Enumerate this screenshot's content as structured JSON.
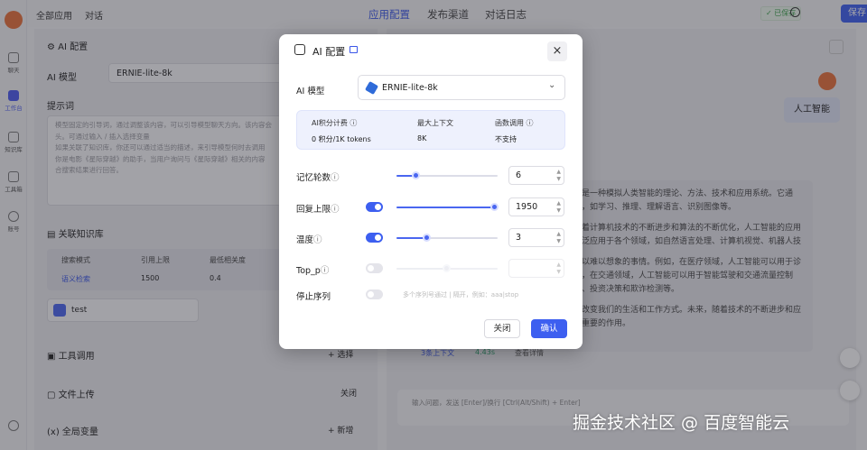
{
  "topbar": {
    "nav_all_apps": "全部应用",
    "nav_chat": "对话",
    "tabs": [
      "应用配置",
      "发布渠道",
      "对话日志"
    ],
    "saved": "✓ 已保存",
    "publish": "保存"
  },
  "rail": {
    "items": [
      "聊天",
      "工作台",
      "知识库",
      "工具箱",
      "账号"
    ]
  },
  "left": {
    "ai_config_title": "AI 配置",
    "model_label": "AI 模型",
    "model_value": "ERNIE-lite-8k",
    "prompt_label": "提示词",
    "prompt_lines": [
      "模型固定的引导词，通过调整该内容，可以引导模型聊天方向。该内容会",
      "头。可通过输入 / 插入选择变量",
      "如果关联了知识库，你还可以通过适当的描述，来引导模型何时去调用",
      "你是电影《星际穿越》的助手，当用户询问与《星际穿越》相关的内容",
      "合搜索结果进行回答。"
    ],
    "kb_title": "关联知识库",
    "kb_headers": [
      "搜索模式",
      "引用上限",
      "最低相关度"
    ],
    "kb_row": [
      "语义检索",
      "1500",
      "0.4"
    ],
    "kb_item": "test",
    "tools_title": "工具调用",
    "tools_action": "+ 选择",
    "upload_title": "文件上传",
    "upload_action": "关闭",
    "vars_title": "全局变量",
    "vars_action": "+ 新增"
  },
  "right": {
    "user_bubble": "人工智能",
    "answer_paragraphs": [
      "是一种模拟人类智能的理论、方法、技术和应用系统。它通",
      "，如学习、推理、理解语言、识别图像等。",
      "着计算机技术的不断进步和算法的不断优化，人工智能的应用",
      "泛应用于各个领域，如自然语言处理、计算机视觉、机器人技",
      "以难以想象的事情。例如，在医疗领域，人工智能可以用于诊",
      "，在交通领域，人工智能可以用于智能驾驶和交通流量控制",
      "、投资决策和欺诈检测等。",
      "改变我们的生活和工作方式。未来，随着技术的不断进步和应",
      "重要的作用。"
    ],
    "meta": [
      "3条上下文",
      "4.43s",
      "查看详情"
    ],
    "input_placeholder": "输入问题，发送 [Enter]/换行 [Ctrl(Alt/Shift) + Enter]"
  },
  "watermark": "掘金技术社区 @ 百度智能云",
  "modal": {
    "title": "AI 配置",
    "model_label": "AI 模型",
    "model_value": "ERNIE-lite-8k",
    "info_headers": [
      "AI积分计费",
      "最大上下文",
      "函数调用"
    ],
    "info_values": [
      "0 积分/1K tokens",
      "8K",
      "不支持"
    ],
    "params": [
      {
        "label": "记忆轮数",
        "value": "6",
        "enabled": true,
        "fraction": 0.2
      },
      {
        "label": "回复上限",
        "value": "1950",
        "enabled": true,
        "fraction": 0.97
      },
      {
        "label": "温度",
        "value": "3",
        "enabled": true,
        "fraction": 0.3
      },
      {
        "label": "Top_p",
        "value": "",
        "enabled": false,
        "fraction": 0.5
      }
    ],
    "stop_label": "停止序列",
    "stop_placeholder": "多个序列号通过 | 隔开，例如：aaa|stop",
    "cancel": "关闭",
    "confirm": "确认",
    "accent": "#3d5ff0"
  }
}
